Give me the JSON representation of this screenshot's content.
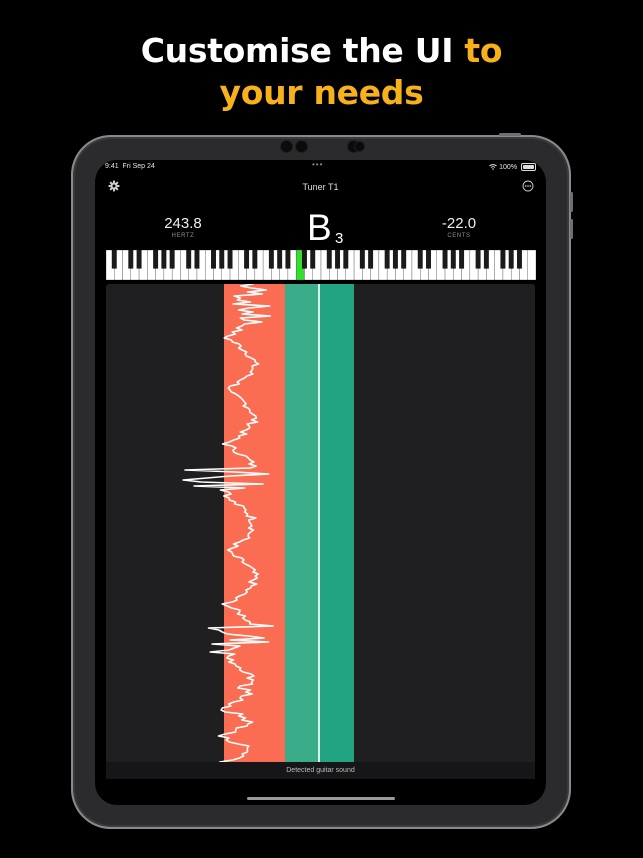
{
  "headline": {
    "line1_prefix": "Customise the UI ",
    "line1_accent": "to",
    "line2_accent": "your needs"
  },
  "colors": {
    "accent": "#f6b11b",
    "wave_red": "#fb6d52",
    "green_light": "#3aac89",
    "green_dark": "#22a382",
    "active_key": "#32e02b"
  },
  "status_bar": {
    "time": "9:41",
    "date": "Fri Sep 24",
    "battery": "100%"
  },
  "nav": {
    "title": "Tuner T1",
    "settings_icon": "gear-icon",
    "more_icon": "ellipsis-circle-icon"
  },
  "readouts": {
    "frequency": {
      "value": "243.8",
      "label": "HERTZ"
    },
    "cents": {
      "value": "-22.0",
      "label": "CENTS"
    }
  },
  "note": {
    "name": "B",
    "octave": "3"
  },
  "keyboard": {
    "white_key_count": 52,
    "active_white_index": 23
  },
  "caption": "Detected guitar sound"
}
